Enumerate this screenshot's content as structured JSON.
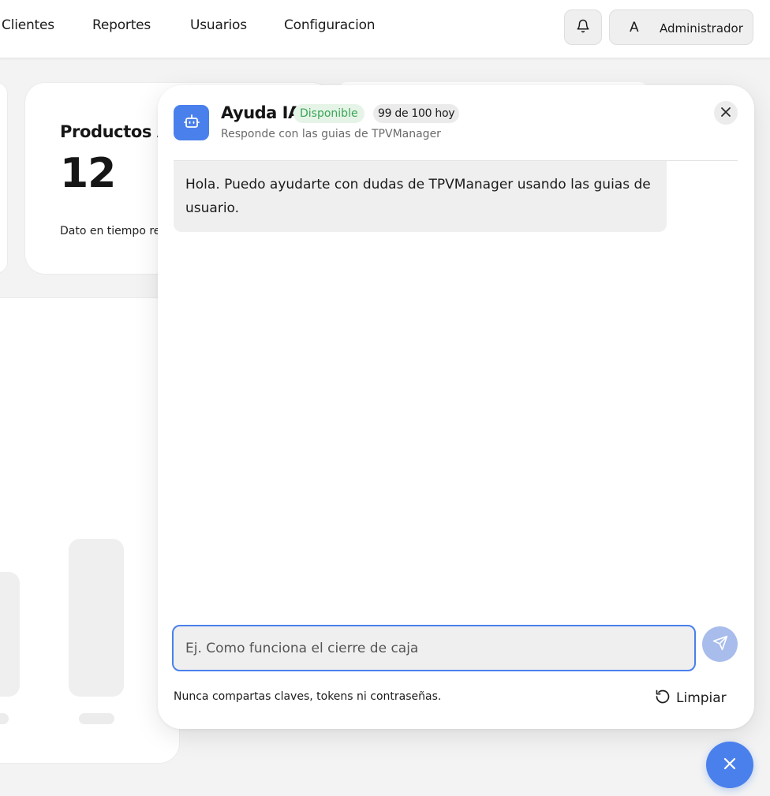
{
  "nav": {
    "links": [
      "Clientes",
      "Reportes",
      "Usuarios",
      "Configuracion"
    ],
    "user": {
      "avatar_letter": "A",
      "name": "Administrador"
    }
  },
  "dashboard": {
    "stat_card": {
      "title": "Productos A",
      "value": "12",
      "note": "Dato en tiempo re"
    }
  },
  "assistant": {
    "title": "Ayuda IA",
    "status": "Disponible",
    "quota": "99 de 100 hoy",
    "subtitle": "Responde con las guias de TPVManager",
    "messages": [
      {
        "role": "assistant",
        "text": "Hola. Puedo ayudarte con dudas de TPVManager usando las guias de usuario."
      }
    ],
    "input": {
      "value": "",
      "placeholder": "Ej. Como funciona el cierre de caja"
    },
    "privacy_note": "Nunca compartas claves, tokens ni contraseñas.",
    "clear_label": "Limpiar"
  },
  "icons": {
    "bell": "bell-icon",
    "bot": "bot-icon",
    "close": "close-icon",
    "send": "send-icon",
    "refresh": "refresh-icon"
  },
  "colors": {
    "accent": "#4a80ec",
    "accent_muted": "#a8bdec",
    "status_green": "#3aa655",
    "status_green_bg": "#e6f4e8"
  }
}
